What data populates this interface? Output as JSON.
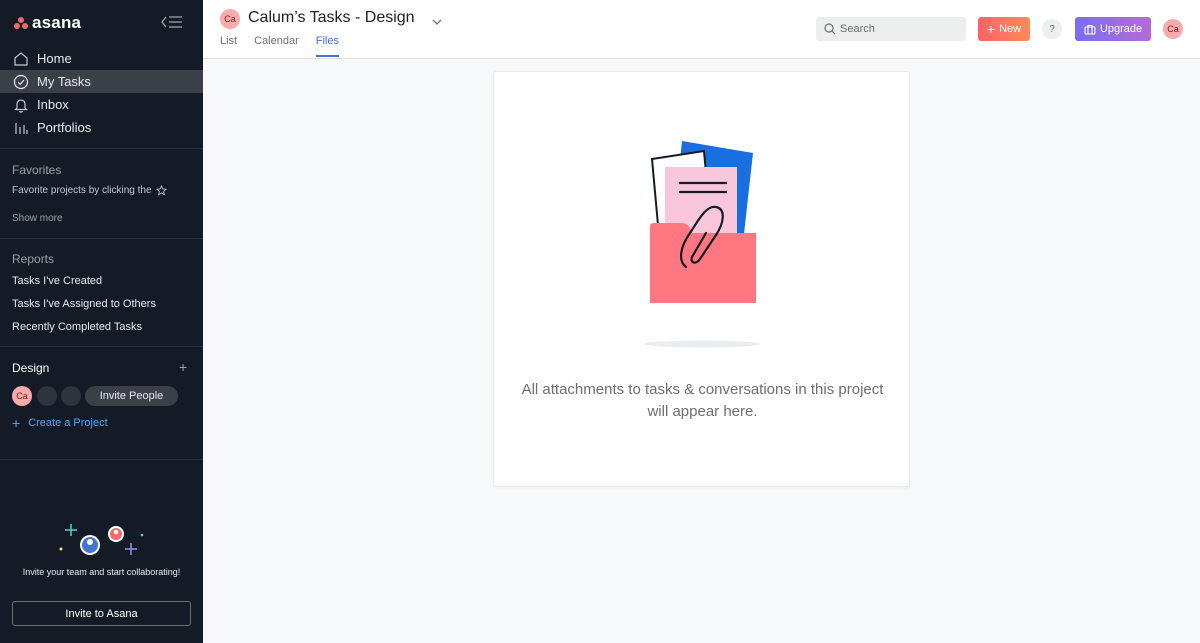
{
  "app": {
    "brand": "asana"
  },
  "sidebar": {
    "nav": [
      {
        "label": "Home",
        "icon": "home-icon"
      },
      {
        "label": "My Tasks",
        "icon": "check-circle-icon",
        "active": true
      },
      {
        "label": "Inbox",
        "icon": "bell-icon"
      },
      {
        "label": "Portfolios",
        "icon": "bar-chart-icon"
      }
    ],
    "favorites": {
      "title": "Favorites",
      "hint": "Favorite projects by clicking the",
      "show_more": "Show more"
    },
    "reports": {
      "title": "Reports",
      "items": [
        "Tasks I've Created",
        "Tasks I've Assigned to Others",
        "Recently Completed Tasks"
      ]
    },
    "team": {
      "name": "Design",
      "member_initials": "Ca",
      "invite_label": "Invite People",
      "create_project": "Create a Project"
    },
    "invite_panel": {
      "text": "Invite your team and start collaborating!",
      "button": "Invite to Asana"
    }
  },
  "header": {
    "project_avatar": "Ca",
    "title": "Calum’s Tasks - Design",
    "tabs": [
      {
        "label": "List"
      },
      {
        "label": "Calendar"
      },
      {
        "label": "Files",
        "active": true
      }
    ],
    "search_placeholder": "Search",
    "new_label": "New",
    "help_label": "?",
    "upgrade_label": "Upgrade",
    "user_initials": "Ca"
  },
  "main": {
    "empty_state": "All attachments to tasks & conversations in this project will appear here."
  },
  "colors": {
    "sidebar_bg": "#151b26",
    "accent_blue": "#4573d2",
    "new_button": "#fc636b",
    "upgrade_button": "#7a6ff0",
    "avatar_pink": "#f9aaaa"
  }
}
